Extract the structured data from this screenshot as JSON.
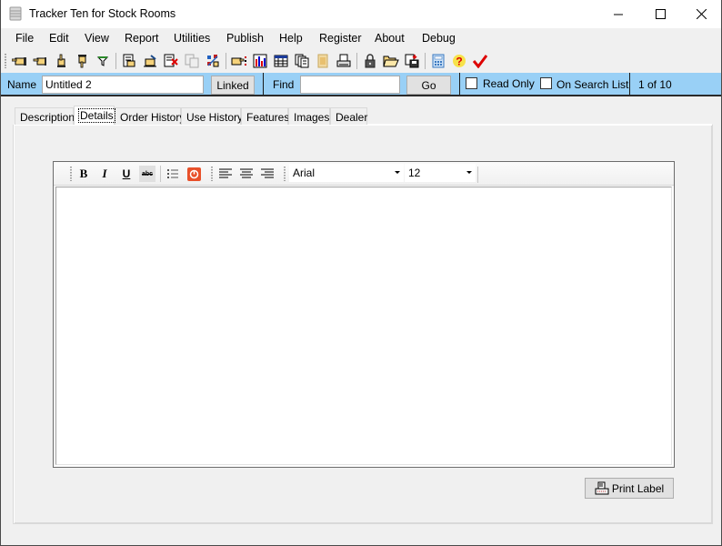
{
  "window": {
    "title": "Tracker Ten for Stock Rooms",
    "icon": "database-icon",
    "controls": [
      "minimize",
      "maximize",
      "close"
    ]
  },
  "menu": {
    "items": [
      "File",
      "Edit",
      "View",
      "Report",
      "Utilities",
      "Publish",
      "Help",
      "Register",
      "About",
      "Debug"
    ]
  },
  "toolbar": {
    "buttons": [
      {
        "name": "first-record",
        "icon": "hand-point-left-first-icon"
      },
      {
        "name": "previous-record",
        "icon": "hand-point-left-icon"
      },
      {
        "name": "add-record",
        "icon": "hand-point-up-icon"
      },
      {
        "name": "next-record",
        "icon": "hand-point-down-icon"
      },
      {
        "name": "filter",
        "icon": "filter-icon"
      },
      {
        "name": "edit-record",
        "icon": "edit-document-icon"
      },
      {
        "name": "edit-field",
        "icon": "hand-write-icon"
      },
      {
        "name": "delete-record",
        "icon": "delete-document-icon"
      },
      {
        "name": "copy-record",
        "icon": "copy-disabled-icon"
      },
      {
        "name": "customize",
        "icon": "tools-icon"
      },
      {
        "name": "goto-record",
        "icon": "hand-point-list-icon"
      },
      {
        "name": "chart",
        "icon": "bar-chart-icon"
      },
      {
        "name": "table-view",
        "icon": "table-icon"
      },
      {
        "name": "documents",
        "icon": "documents-icon"
      },
      {
        "name": "image",
        "icon": "film-icon"
      },
      {
        "name": "print",
        "icon": "printer-icon"
      },
      {
        "name": "lock",
        "icon": "lock-icon"
      },
      {
        "name": "open",
        "icon": "folder-open-icon"
      },
      {
        "name": "save",
        "icon": "save-icon"
      },
      {
        "name": "calculator",
        "icon": "calculator-icon"
      },
      {
        "name": "help",
        "icon": "question-icon"
      },
      {
        "name": "spellcheck",
        "icon": "checkmark-icon"
      }
    ]
  },
  "namebar": {
    "name_label": "Name",
    "name_value": "Untitled 2",
    "linked_label": "Linked",
    "find_label": "Find",
    "find_value": "",
    "go_label": "Go",
    "read_only_label": "Read Only",
    "read_only_checked": false,
    "on_search_list_label": "On Search List",
    "on_search_list_checked": false,
    "record_counter": "1 of 10"
  },
  "tabs": {
    "items": [
      "Description",
      "Details",
      "Order History",
      "Use History",
      "Features",
      "Images",
      "Dealer"
    ],
    "active": "Details"
  },
  "editor": {
    "bold": "B",
    "italic": "I",
    "underline": "U",
    "strike": "abc",
    "font_name": "Arial",
    "font_size": "12",
    "content": ""
  },
  "print_label": {
    "label": "Print Label"
  }
}
